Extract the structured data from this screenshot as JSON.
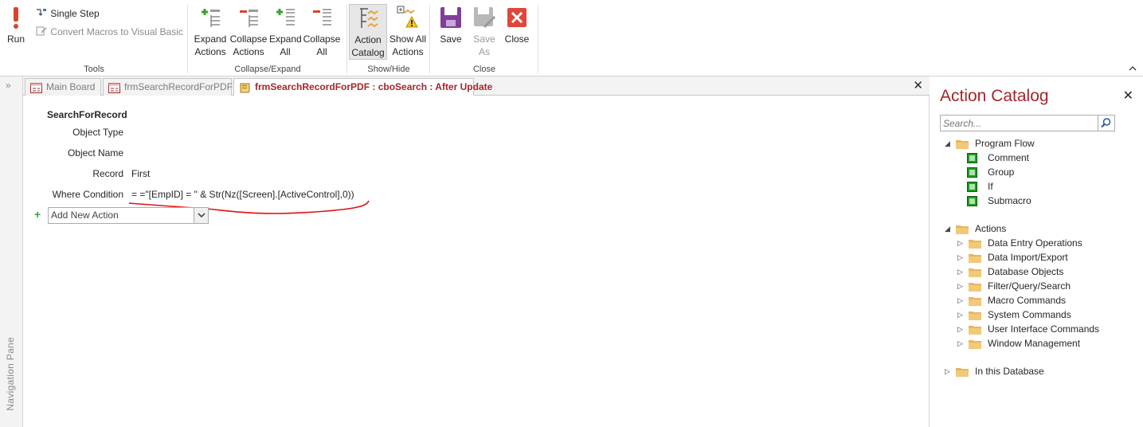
{
  "ribbon": {
    "tools": {
      "run_label": "Run",
      "single_step_label": "Single Step",
      "convert_label": "Convert Macros to Visual Basic",
      "group_label": "Tools"
    },
    "collapse_expand": {
      "expand_actions_label_1": "Expand",
      "expand_actions_label_2": "Actions",
      "collapse_actions_label_1": "Collapse",
      "collapse_actions_label_2": "Actions",
      "expand_all_label_1": "Expand",
      "expand_all_label_2": "All",
      "collapse_all_label_1": "Collapse",
      "collapse_all_label_2": "All",
      "group_label": "Collapse/Expand"
    },
    "show_hide": {
      "action_catalog_label_1": "Action",
      "action_catalog_label_2": "Catalog",
      "show_all_label_1": "Show All",
      "show_all_label_2": "Actions",
      "group_label": "Show/Hide"
    },
    "close_group": {
      "save_label": "Save",
      "save_as_label_1": "Save",
      "save_as_label_2": "As",
      "close_label": "Close",
      "group_label": "Close"
    },
    "collapse_ribbon_icon": "chevron-up"
  },
  "nav_pane": {
    "label": "Navigation Pane",
    "expand_glyph": "»"
  },
  "tabs": [
    {
      "label": "Main Board",
      "active": false
    },
    {
      "label": "frmSearchRecordForPDF",
      "active": false
    },
    {
      "label": "frmSearchRecordForPDF : cboSearch : After Update",
      "active": true
    }
  ],
  "editor": {
    "action_name": "SearchForRecord",
    "arguments": [
      {
        "label": "Object Type",
        "value": ""
      },
      {
        "label": "Object Name",
        "value": ""
      },
      {
        "label": "Record",
        "value": "First"
      },
      {
        "label": "Where Condition",
        "value": "= =\"[EmpID] = \" & Str(Nz([Screen].[ActiveControl],0))"
      }
    ],
    "add_new_action": "Add New Action"
  },
  "catalog": {
    "title": "Action Catalog",
    "search_placeholder": "Search...",
    "program_flow": {
      "label": "Program Flow",
      "items": [
        "Comment",
        "Group",
        "If",
        "Submacro"
      ]
    },
    "actions": {
      "label": "Actions",
      "items": [
        "Data Entry Operations",
        "Data Import/Export",
        "Database Objects",
        "Filter/Query/Search",
        "Macro Commands",
        "System Commands",
        "User Interface Commands",
        "Window Management"
      ]
    },
    "in_this_database": "In this Database"
  },
  "colors": {
    "accent_red": "#a4262c",
    "run_red": "#d9442b",
    "save_purple": "#7f3f98",
    "close_red": "#e0473a",
    "green_item": "#1e9b1e",
    "folder": "#e8b75c",
    "annotation_red": "#e01010"
  }
}
